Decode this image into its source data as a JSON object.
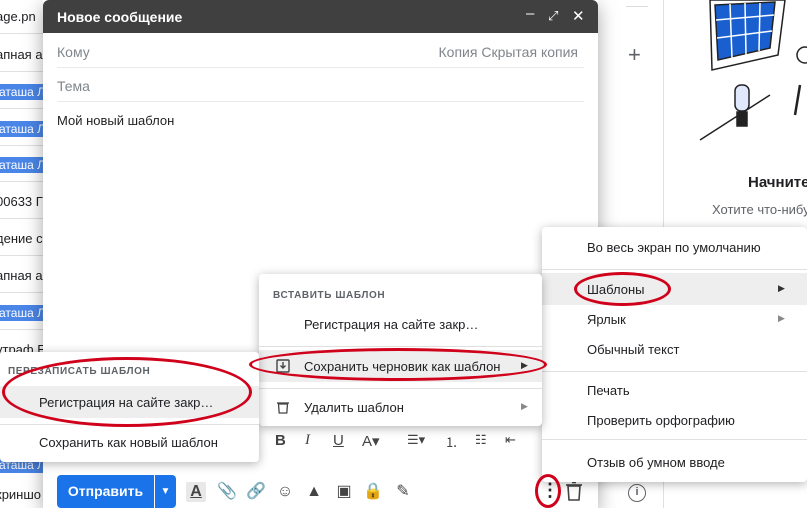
{
  "background_list": {
    "rows": [
      {
        "text": "age.pn",
        "highlight": false
      },
      {
        "text": "апная а",
        "highlight": false
      },
      {
        "text": "аташа Л",
        "highlight": true
      },
      {
        "text": "аташа Л",
        "highlight": true
      },
      {
        "text": "аташа Л",
        "highlight": true
      },
      {
        "text": "00633 Г",
        "highlight": false
      },
      {
        "text": "дение с",
        "highlight": false
      },
      {
        "text": "апная а",
        "highlight": false
      },
      {
        "text": "аташа Л",
        "highlight": true
      },
      {
        "text": "утраф Е",
        "highlight": false
      },
      {
        "text": "",
        "highlight": false
      },
      {
        "text": "",
        "highlight": false
      },
      {
        "text": "",
        "highlight": false
      },
      {
        "text": "аташа Л",
        "highlight": true
      },
      {
        "text": "криншо",
        "highlight": false
      }
    ]
  },
  "compose": {
    "title": "Новое сообщение",
    "to_label": "Кому",
    "cc_label": "Копия Скрытая копия",
    "subject_placeholder": "Тема",
    "body_text": "Мой новый шаблон",
    "send_label": "Отправить"
  },
  "right_panel": {
    "title": "Начните",
    "subtitle": "Хотите что-нибу"
  },
  "more_menu": {
    "items": [
      {
        "label": "Во весь экран по умолчанию",
        "submenu": false
      },
      {
        "label": "Шаблоны",
        "submenu": true,
        "active": true
      },
      {
        "label": "Ярлык",
        "submenu": true
      },
      {
        "label": "Обычный текст",
        "submenu": false
      },
      {
        "label": "Печать",
        "submenu": false
      },
      {
        "label": "Проверить орфографию",
        "submenu": false
      },
      {
        "label": "Отзыв об умном вводе",
        "submenu": false
      }
    ]
  },
  "templates_menu": {
    "insert_header": "ВСТАВИТЬ ШАБЛОН",
    "insert_item": "Регистрация на сайте закр…",
    "save_draft": "Сохранить черновик как шаблон",
    "delete_template": "Удалить шаблон"
  },
  "overwrite_menu": {
    "header": "ПЕРЕЗАПИСАТЬ ШАБЛОН",
    "item": "Регистрация на сайте закр…",
    "save_new": "Сохранить как новый шаблон"
  },
  "colors": {
    "header_bg": "#404040",
    "send_blue": "#1a73e8",
    "highlight_blue": "#4a86e8",
    "annotation_red": "#d0021b"
  }
}
